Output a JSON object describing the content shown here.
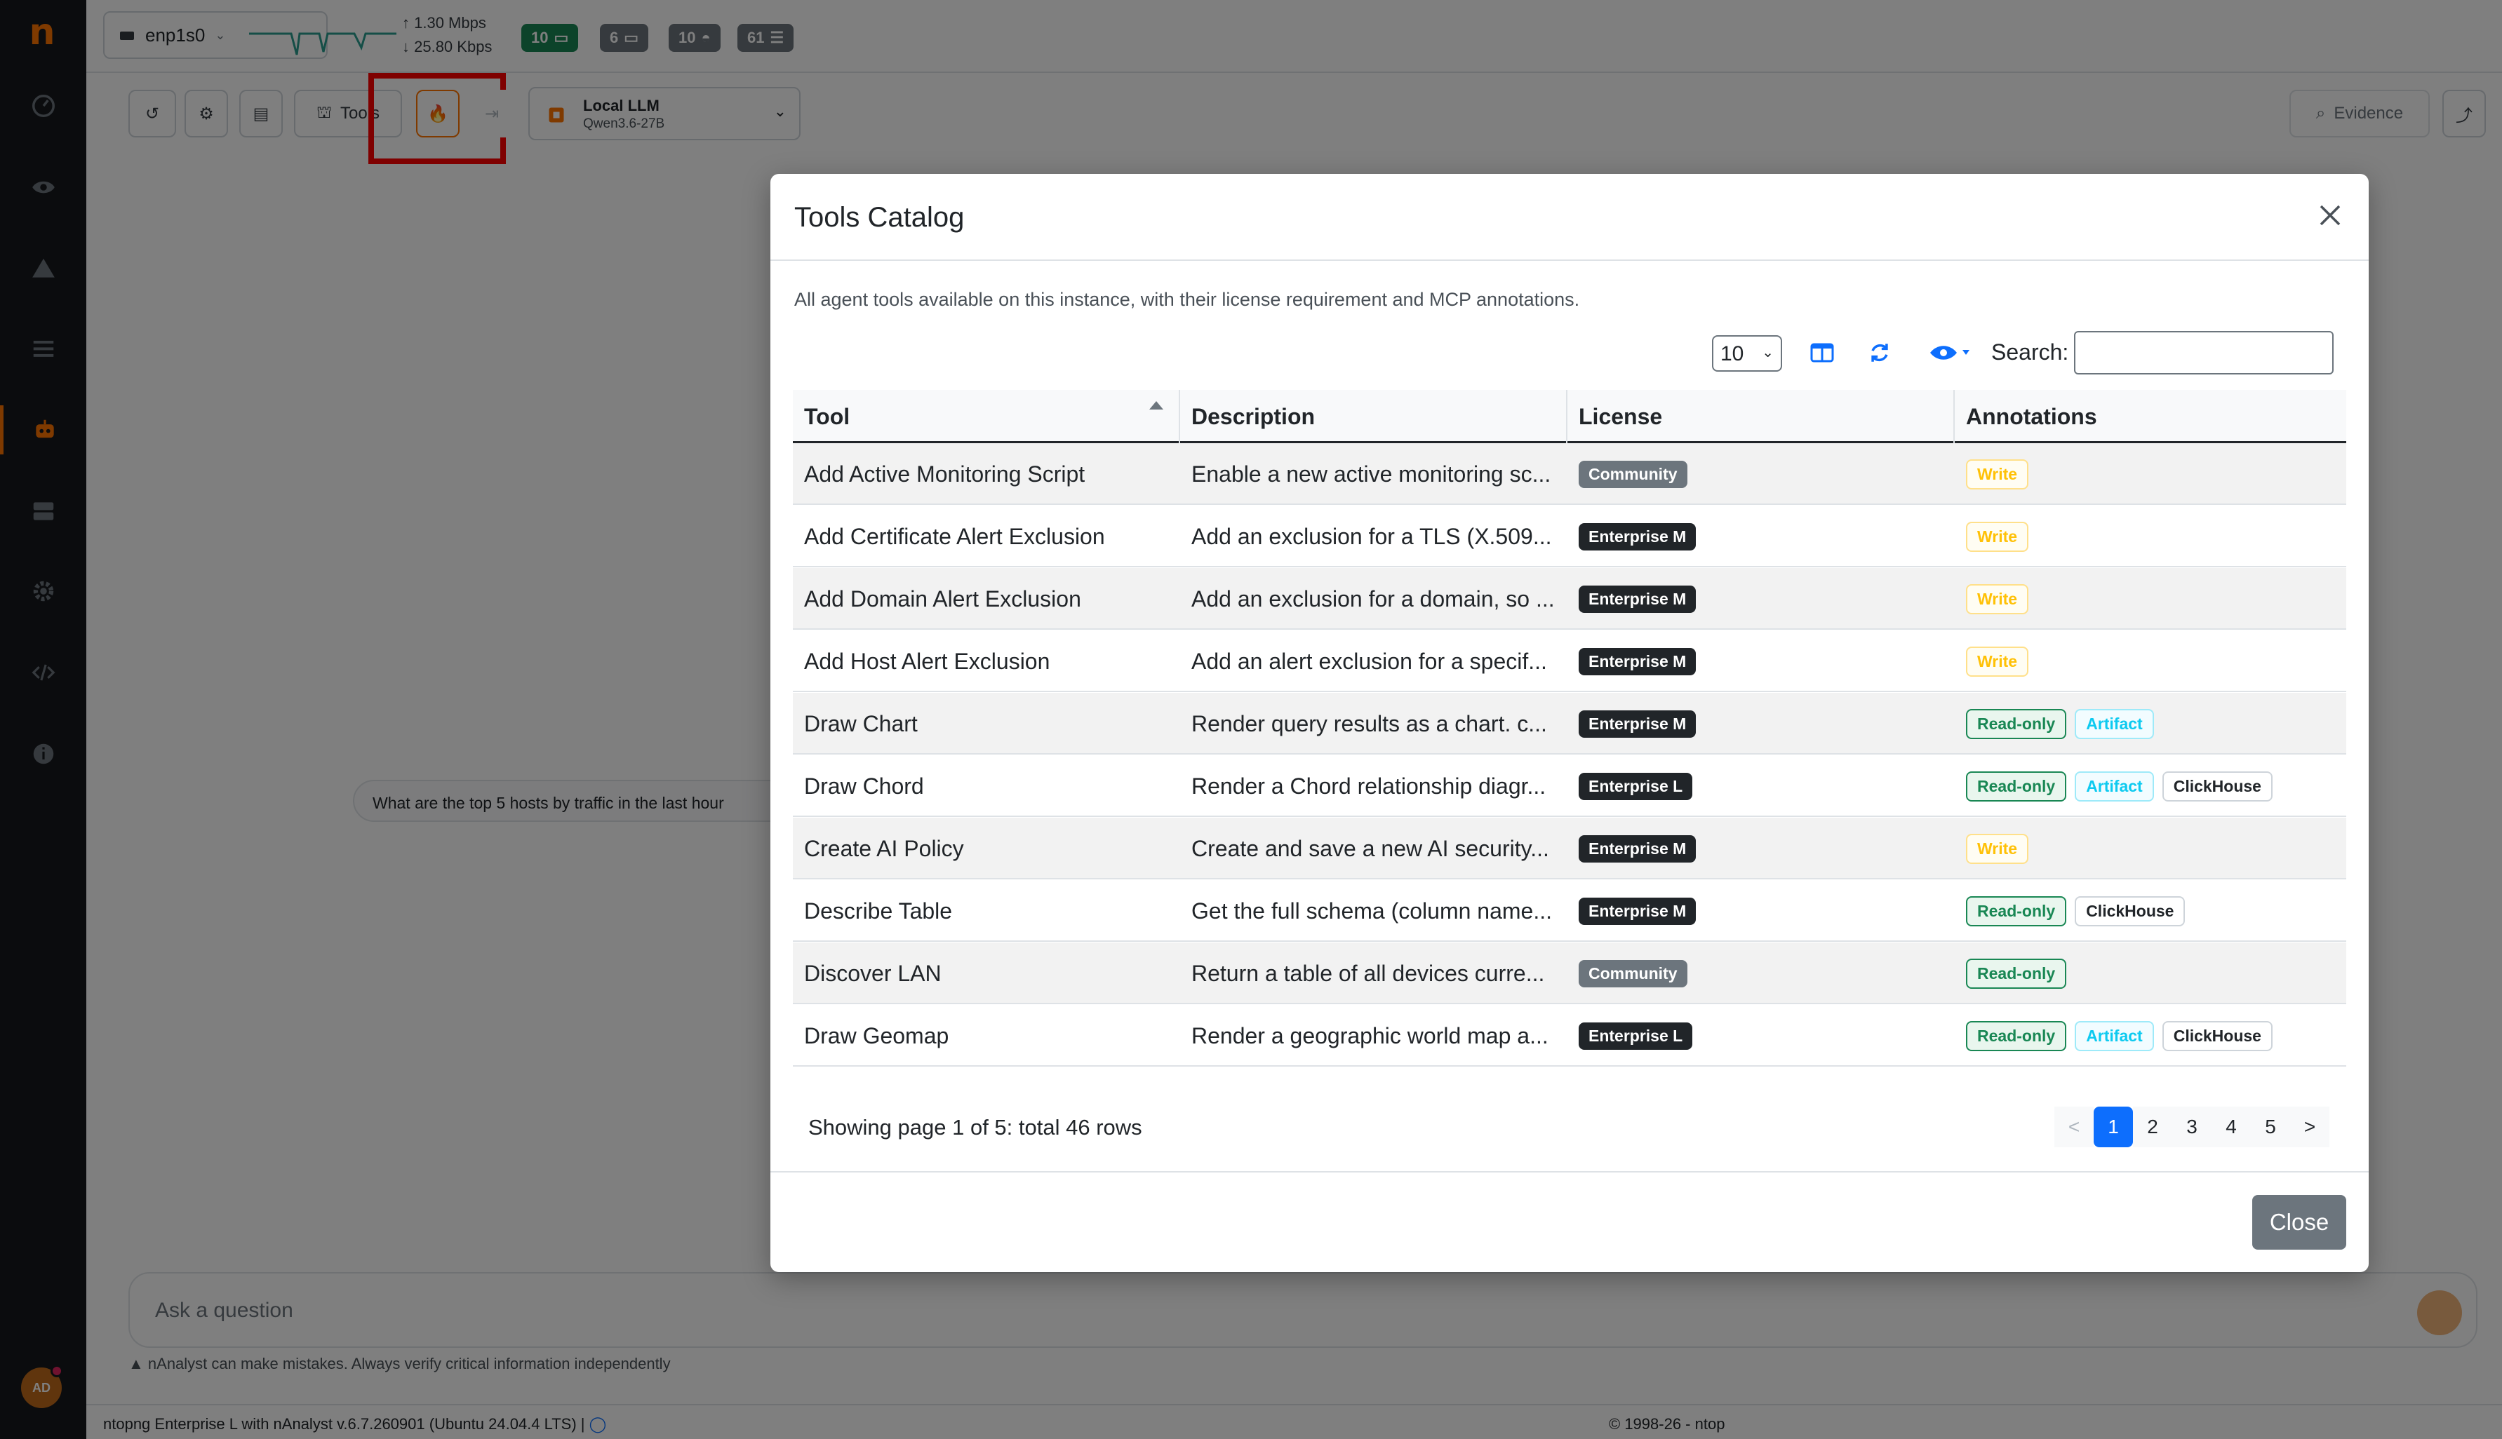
{
  "sidebar": {
    "logo_letter": "n",
    "avatar_initials": "AD",
    "accent": "#ff7500"
  },
  "topbar": {
    "interface": "enp1s0",
    "upload_rate": "↑ 1.30 Mbps",
    "download_rate": "↓ 25.80 Kbps",
    "badges": [
      {
        "value": "10",
        "icon": "laptop-icon",
        "color": "#198754"
      },
      {
        "value": "6",
        "icon": "laptop-icon",
        "color": "#6c757d"
      },
      {
        "value": "10",
        "icon": "lan-icon",
        "color": "#6c757d"
      },
      {
        "value": "61",
        "icon": "list-icon",
        "color": "#6c757d"
      }
    ]
  },
  "toolbar": {
    "tools_label": "Tools",
    "llm_title": "Local LLM",
    "llm_model": "Qwen3.6-27B",
    "evidence_label": "Evidence"
  },
  "chat": {
    "user_question": "What are the top 5 hosts by traffic in the last hour",
    "ask_placeholder": "Ask a question",
    "disclaimer": "nAnalyst can make mistakes. Always verify critical information independently"
  },
  "footer": {
    "left": "ntopng Enterprise L with nAnalyst v.6.7.260901 (Ubuntu 24.04.4 LTS) |",
    "center": "© 1998-26 - ntop"
  },
  "modal": {
    "title": "Tools Catalog",
    "description": "All agent tools available on this instance, with their license requirement and MCP annotations.",
    "page_size": "10",
    "search_label": "Search:",
    "search_value": "",
    "columns": [
      "Tool",
      "Description",
      "License",
      "Annotations"
    ],
    "rows": [
      {
        "tool": "Add Active Monitoring Script",
        "description": "Enable a new active monitoring sc...",
        "license": "Community",
        "annotations": [
          "Write"
        ]
      },
      {
        "tool": "Add Certificate Alert Exclusion",
        "description": "Add an exclusion for a TLS (X.509...",
        "license": "Enterprise M",
        "annotations": [
          "Write"
        ]
      },
      {
        "tool": "Add Domain Alert Exclusion",
        "description": "Add an exclusion for a domain, so ...",
        "license": "Enterprise M",
        "annotations": [
          "Write"
        ]
      },
      {
        "tool": "Add Host Alert Exclusion",
        "description": "Add an alert exclusion for a specif...",
        "license": "Enterprise M",
        "annotations": [
          "Write"
        ]
      },
      {
        "tool": "Draw Chart",
        "description": "Render query results as a chart. c...",
        "license": "Enterprise M",
        "annotations": [
          "Read-only",
          "Artifact"
        ]
      },
      {
        "tool": "Draw Chord",
        "description": "Render a Chord relationship diagr...",
        "license": "Enterprise L",
        "annotations": [
          "Read-only",
          "Artifact",
          "ClickHouse"
        ]
      },
      {
        "tool": "Create AI Policy",
        "description": "Create and save a new AI security...",
        "license": "Enterprise M",
        "annotations": [
          "Write"
        ]
      },
      {
        "tool": "Describe Table",
        "description": "Get the full schema (column name...",
        "license": "Enterprise M",
        "annotations": [
          "Read-only",
          "ClickHouse"
        ]
      },
      {
        "tool": "Discover LAN",
        "description": "Return a table of all devices curre...",
        "license": "Community",
        "annotations": [
          "Read-only"
        ]
      },
      {
        "tool": "Draw Geomap",
        "description": "Render a geographic world map a...",
        "license": "Enterprise L",
        "annotations": [
          "Read-only",
          "Artifact",
          "ClickHouse"
        ]
      }
    ],
    "pagination_info": "Showing page 1 of 5: total 46 rows",
    "pages": [
      "<",
      "1",
      "2",
      "3",
      "4",
      "5",
      ">"
    ],
    "active_page": "1",
    "close_label": "Close"
  }
}
